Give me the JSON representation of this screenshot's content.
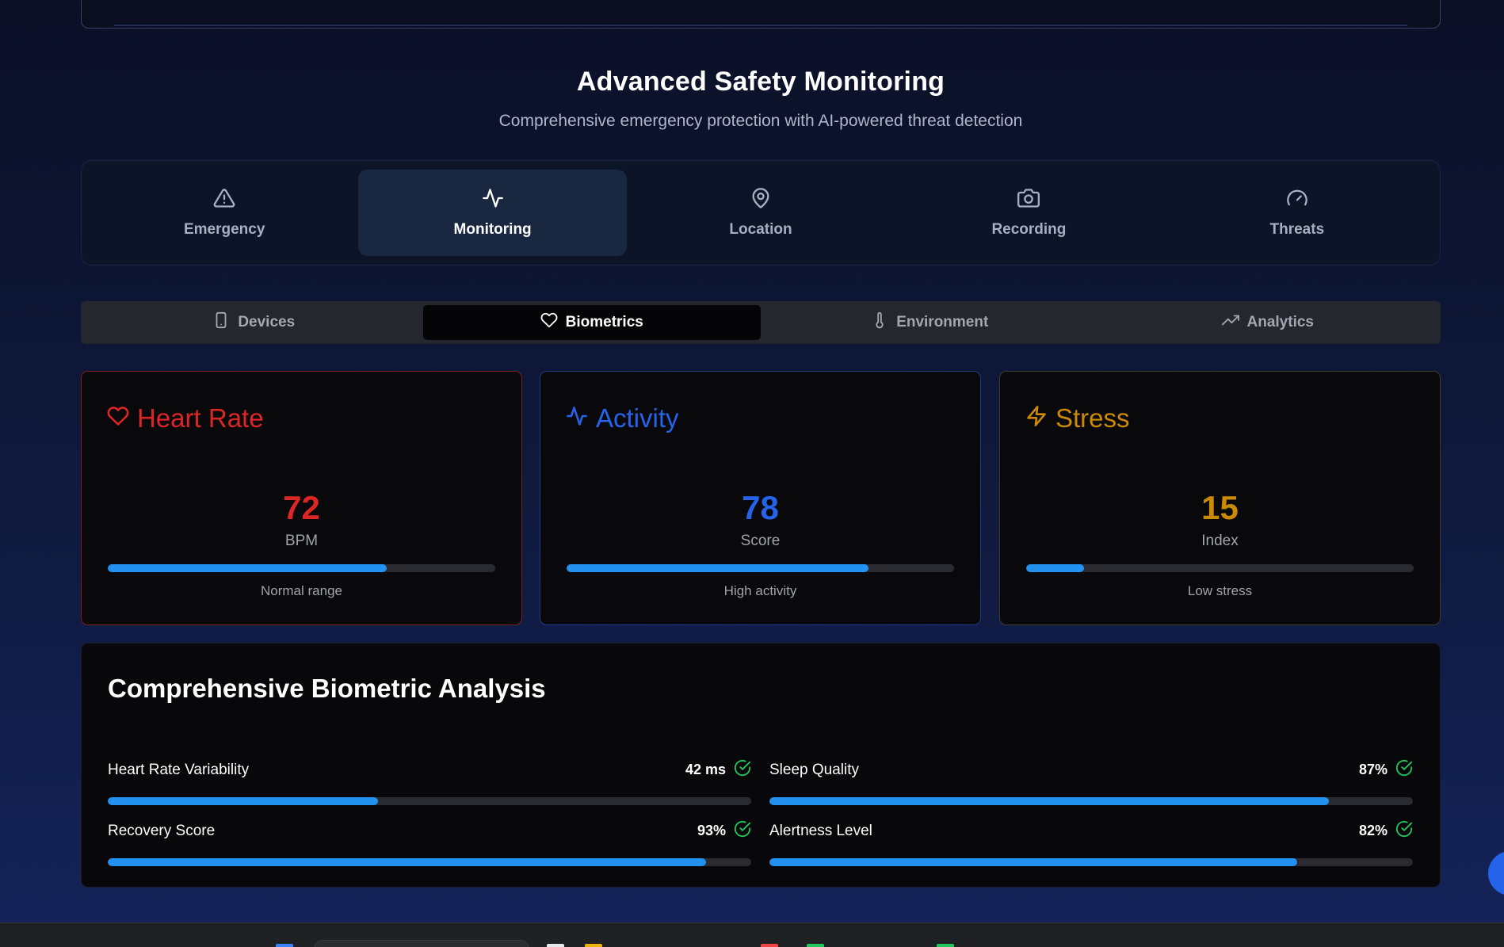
{
  "header": {
    "title": "Advanced Safety Monitoring",
    "subtitle": "Comprehensive emergency protection with AI-powered threat detection"
  },
  "main_tabs": [
    {
      "label": "Emergency",
      "icon": "alert-triangle-icon",
      "active": false
    },
    {
      "label": "Monitoring",
      "icon": "activity-icon",
      "active": true
    },
    {
      "label": "Location",
      "icon": "map-pin-icon",
      "active": false
    },
    {
      "label": "Recording",
      "icon": "camera-icon",
      "active": false
    },
    {
      "label": "Threats",
      "icon": "gauge-icon",
      "active": false
    }
  ],
  "sub_tabs": [
    {
      "label": "Devices",
      "icon": "smartphone-icon",
      "active": false
    },
    {
      "label": "Biometrics",
      "icon": "heart-icon",
      "active": true
    },
    {
      "label": "Environment",
      "icon": "thermometer-icon",
      "active": false
    },
    {
      "label": "Analytics",
      "icon": "trending-up-icon",
      "active": false
    }
  ],
  "metrics": [
    {
      "title": "Heart Rate",
      "icon": "heart-icon",
      "value": "72",
      "unit": "BPM",
      "progress": 0.72,
      "note": "Normal range",
      "color": "#dc2626",
      "border": "#7f1d1d"
    },
    {
      "title": "Activity",
      "icon": "activity-icon",
      "value": "78",
      "unit": "Score",
      "progress": 0.78,
      "note": "High activity",
      "color": "#2563eb",
      "border": "#1e3a8a"
    },
    {
      "title": "Stress",
      "icon": "zap-icon",
      "value": "15",
      "unit": "Index",
      "progress": 0.15,
      "note": "Low stress",
      "color": "#ca8a04",
      "border": "#3f3a2a"
    }
  ],
  "analysis": {
    "title": "Comprehensive Biometric Analysis",
    "items": [
      {
        "name": "Heart Rate Variability",
        "value": "42 ms",
        "progress": 0.42
      },
      {
        "name": "Sleep Quality",
        "value": "87%",
        "progress": 0.87
      },
      {
        "name": "Recovery Score",
        "value": "93%",
        "progress": 0.93
      },
      {
        "name": "Alertness Level",
        "value": "82%",
        "progress": 0.82
      }
    ]
  },
  "colors": {
    "accent_bar": "#2391f0",
    "check": "#22c55e"
  }
}
